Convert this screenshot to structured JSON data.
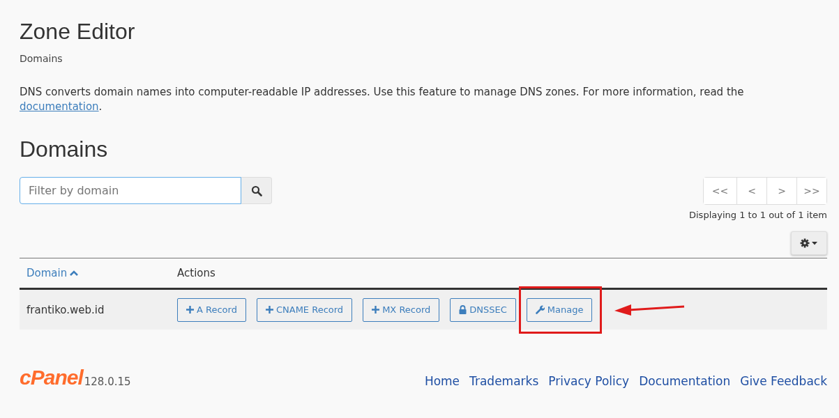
{
  "page": {
    "title": "Zone Editor",
    "breadcrumb": "Domains",
    "description": "DNS converts domain names into computer-readable IP addresses. Use this feature to manage DNS zones. For more information, read the ",
    "description_link": "documentation",
    "description_end": "."
  },
  "section": {
    "heading": "Domains"
  },
  "search": {
    "placeholder": "Filter by domain",
    "focused": true
  },
  "pagination": {
    "buttons": [
      "<<",
      "<",
      ">",
      ">>"
    ],
    "summary": "Displaying 1 to 1 out of 1 item"
  },
  "table": {
    "columns": [
      {
        "label": "Domain",
        "sorted": true
      },
      {
        "label": "Actions",
        "sorted": false
      }
    ],
    "rows": [
      {
        "domain": "frantiko.web.id",
        "actions": [
          {
            "label": "A Record",
            "kind": "add",
            "highlighted": false
          },
          {
            "label": "CNAME Record",
            "kind": "add",
            "highlighted": false
          },
          {
            "label": "MX Record",
            "kind": "add",
            "highlighted": false
          },
          {
            "label": "DNSSEC",
            "kind": "lock",
            "highlighted": false
          },
          {
            "label": "Manage",
            "kind": "wrench",
            "highlighted": true
          }
        ]
      }
    ]
  },
  "footer": {
    "logo": "cPanel",
    "version": "128.0.15",
    "links": [
      "Home",
      "Trademarks",
      "Privacy Policy",
      "Documentation",
      "Give Feedback"
    ]
  }
}
